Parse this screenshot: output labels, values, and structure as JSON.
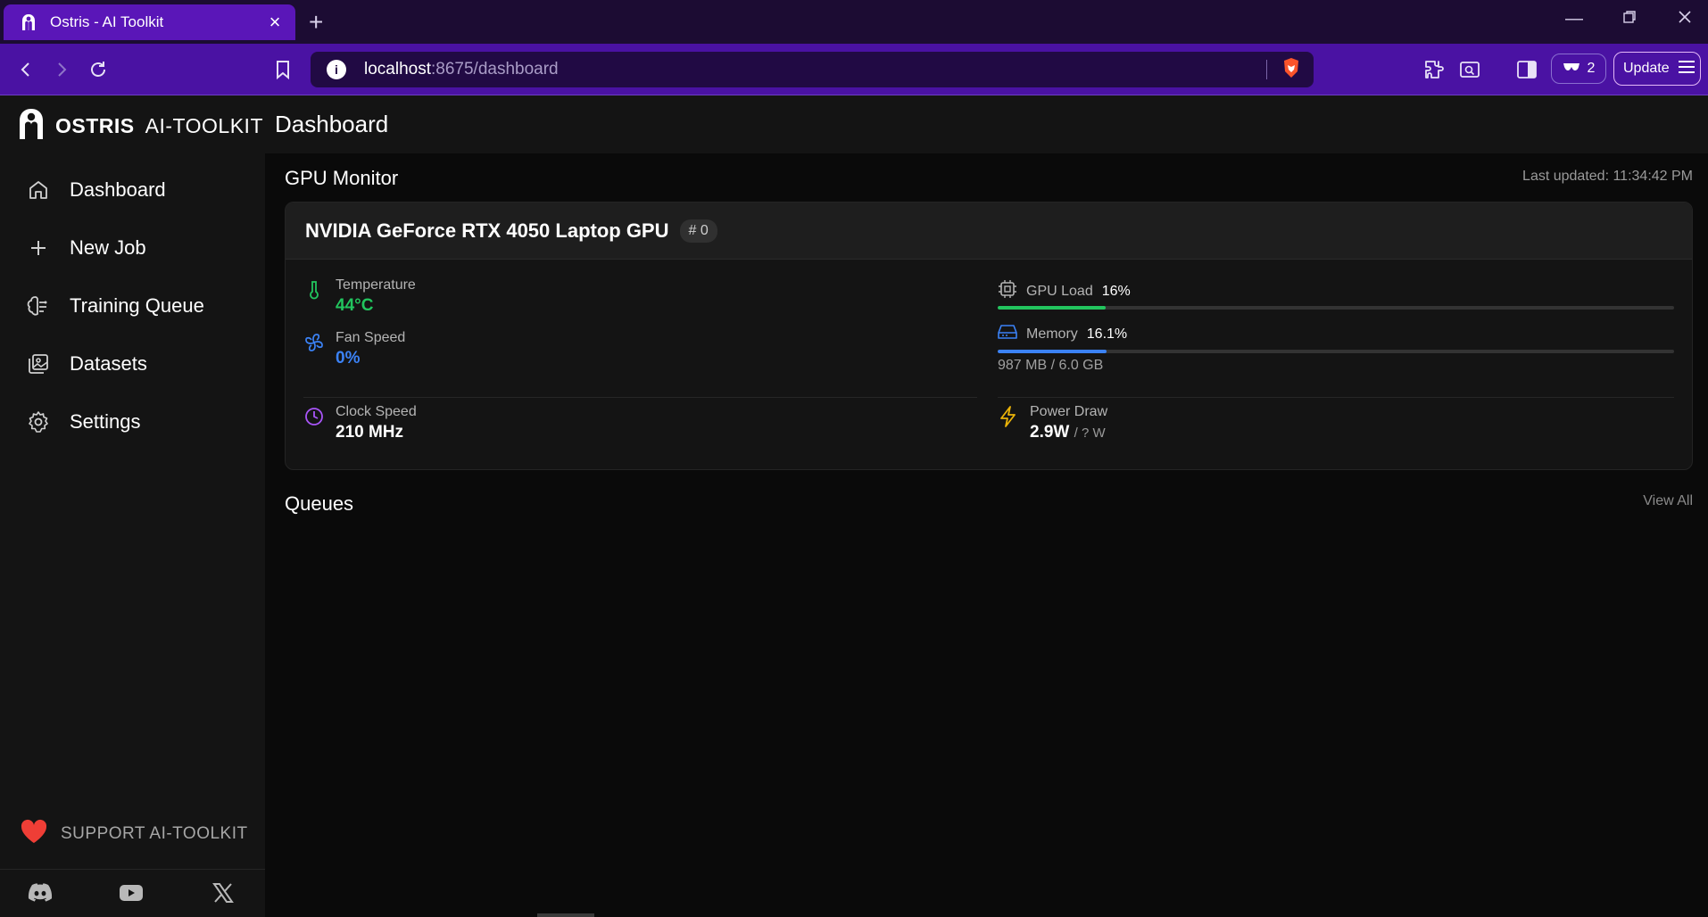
{
  "browser": {
    "tab_title": "Ostris - AI Toolkit",
    "url_host": "localhost",
    "url_path": ":8675/dashboard",
    "extension_count": "2",
    "update_label": "Update"
  },
  "brand": {
    "bold": "OSTRIS",
    "light": "AI-TOOLKIT"
  },
  "header": {
    "title": "Dashboard"
  },
  "sidebar": {
    "items": [
      {
        "label": "Dashboard",
        "icon": "home-icon"
      },
      {
        "label": "New Job",
        "icon": "plus-icon"
      },
      {
        "label": "Training Queue",
        "icon": "brain-icon"
      },
      {
        "label": "Datasets",
        "icon": "images-icon"
      },
      {
        "label": "Settings",
        "icon": "gear-icon"
      }
    ],
    "support_label": "SUPPORT AI-TOOLKIT"
  },
  "gpu_monitor": {
    "title": "GPU Monitor",
    "last_updated": "Last updated: 11:34:42 PM",
    "gpu_name": "NVIDIA GeForce RTX 4050 Laptop GPU",
    "gpu_index": "# 0",
    "temperature": {
      "label": "Temperature",
      "value": "44°C",
      "color": "#22c55e"
    },
    "fan_speed": {
      "label": "Fan Speed",
      "value": "0%",
      "color": "#3b82f6"
    },
    "clock_speed": {
      "label": "Clock Speed",
      "value": "210 MHz"
    },
    "gpu_load": {
      "label": "GPU Load",
      "value": "16%",
      "fraction": 0.16,
      "color": "#22c55e"
    },
    "memory": {
      "label": "Memory",
      "value": "16.1%",
      "fraction": 0.161,
      "detail": "987 MB / 6.0 GB",
      "color": "#3b82f6"
    },
    "power_draw": {
      "label": "Power Draw",
      "value": "2.9W",
      "limit": "/ ? W"
    }
  },
  "queues": {
    "title": "Queues",
    "view_all": "View All"
  }
}
